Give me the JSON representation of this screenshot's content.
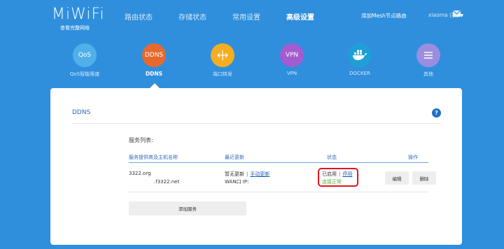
{
  "header": {
    "logo": "MiWiFi",
    "logo_sub": "查看完整网络",
    "nav": [
      "路由状态",
      "存储状态",
      "常用设置",
      "高级设置"
    ],
    "active_nav": "高级设置",
    "mesh_link": "添加Mesh节点路由",
    "user": "xiaoma (家)"
  },
  "functions": [
    {
      "icon_text": "QoS",
      "label": "QoS智能限速",
      "color": "#4fb0ea"
    },
    {
      "icon_text": "DDNS",
      "label": "DDNS",
      "color": "#e7692d"
    },
    {
      "icon_text": "",
      "label": "端口转发",
      "color": "#f5ad22"
    },
    {
      "icon_text": "VPN",
      "label": "VPN",
      "color": "#a25ccf"
    },
    {
      "icon_text": "",
      "label": "DOCKER",
      "color": "#1f9fd8"
    },
    {
      "icon_text": "",
      "label": "其他",
      "color": "#9b8de0"
    }
  ],
  "card": {
    "title": "DDNS",
    "list_title": "服务列表:",
    "columns": [
      "服务提供商及主机名称",
      "最近更新",
      "状态",
      "操作"
    ],
    "row": {
      "provider": "3322.org",
      "host": ".f3322.net",
      "update_status": "暂无更新",
      "manual_update": "手动更新",
      "wan_ip": "WAN口 IP:",
      "enabled": "已启用",
      "disable": "停用",
      "connection": "连接正常",
      "edit": "编辑",
      "delete": "删除"
    },
    "add_button": "添加服务"
  },
  "colors": {
    "background": "#2f8fdd",
    "highlight_box": "#e0141e",
    "ok": "#5bb531"
  }
}
